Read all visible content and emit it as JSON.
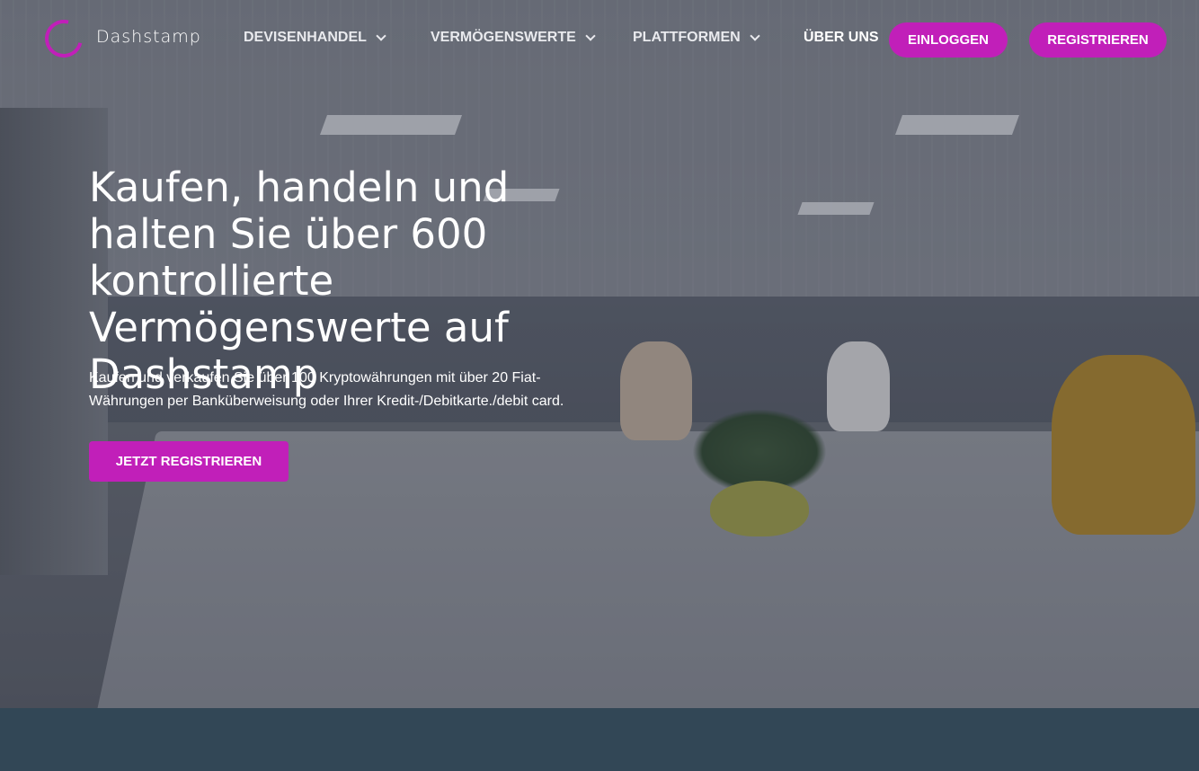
{
  "brand": {
    "name": "Dashstamp",
    "accent": "#c11fb9"
  },
  "nav": {
    "items": [
      {
        "label": "DEVISENHANDEL",
        "has_dropdown": true,
        "icon": "chevron-down-icon"
      },
      {
        "label": "VERMÖGENSWERTE",
        "has_dropdown": true,
        "icon": "chevron-down-icon"
      },
      {
        "label": "PLATTFORMEN",
        "has_dropdown": true,
        "icon": "chevron-down-icon"
      },
      {
        "label": "ÜBER UNS",
        "has_dropdown": false
      }
    ],
    "login_label": "EINLOGGEN",
    "register_label": "REGISTRIEREN"
  },
  "hero": {
    "title": "Kaufen, handeln und halten Sie über 600 kontrollierte Vermögenswerte auf Dashstamp",
    "subtitle": "Kaufen und verkaufen Sie über 100 Kryptowährungen mit über 20 Fiat-Währungen per Banküberweisung oder Ihrer Kredit-/Debitkarte./debit card.",
    "cta_label": "JETZT REGISTRIEREN",
    "background": "office-photo"
  },
  "colors": {
    "footer_band": "#324756"
  }
}
